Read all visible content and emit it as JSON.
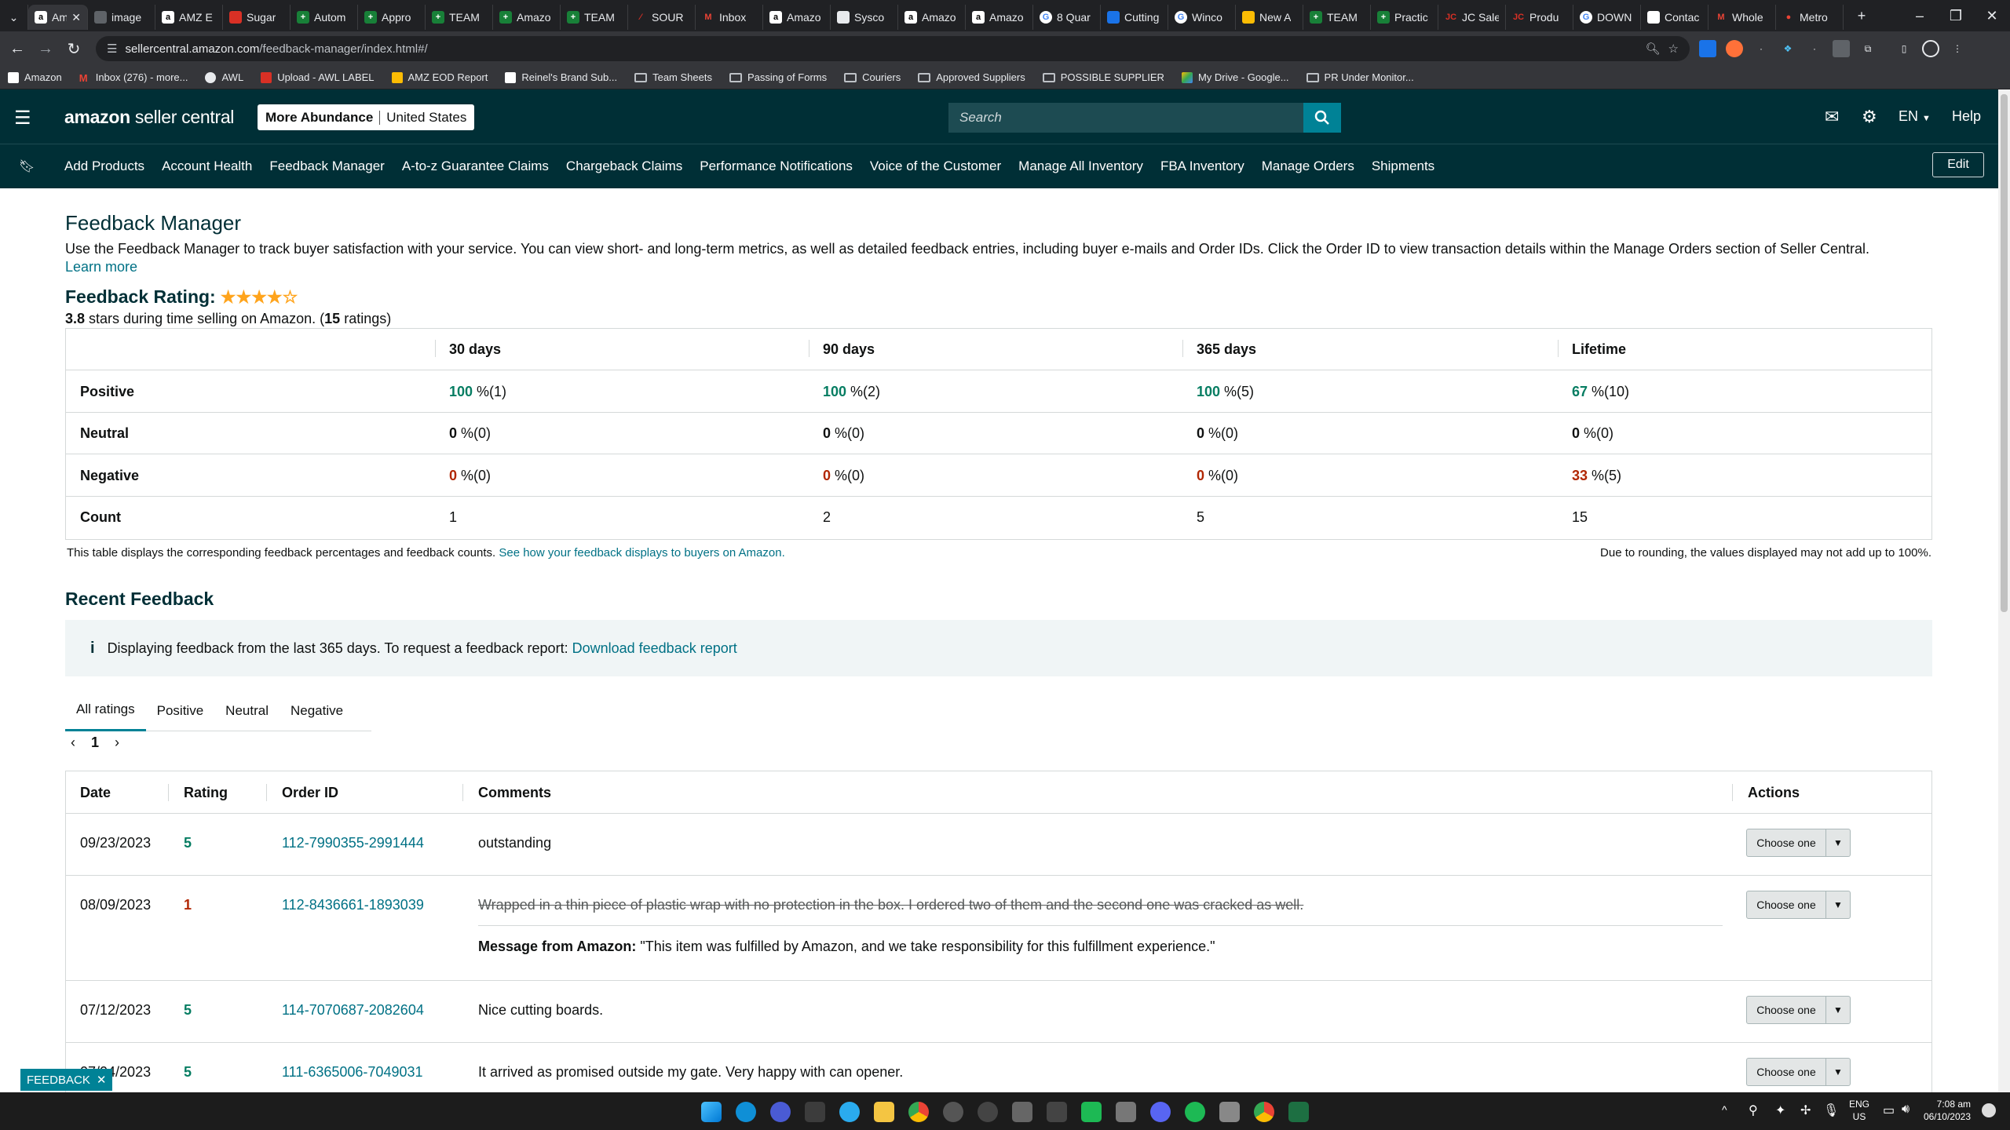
{
  "browser": {
    "tabs": [
      "Am",
      "image",
      "AMZ E",
      "Sugar",
      "Autom",
      "Appro",
      "TEAM",
      "Amazo",
      "TEAM",
      "SOUR",
      "Inbox",
      "Amazo",
      "Sysco",
      "Amazo",
      "Amazo",
      "8 Quar",
      "Cutting",
      "Winco",
      "New A",
      "TEAM",
      "Practic",
      "JC Sale",
      "Produ",
      "DOWN",
      "Contac",
      "Whole",
      "Metro"
    ],
    "url_domain": "sellercentral.amazon.com",
    "url_path": "/feedback-manager/index.html#/",
    "bookmarks": [
      "Amazon",
      "Inbox (276) - more...",
      "AWL",
      "Upload - AWL LABEL",
      "AMZ EOD Report",
      "Reinel's Brand Sub...",
      "Team Sheets",
      "Passing of Forms",
      "Couriers",
      "Approved Suppliers",
      "POSSIBLE SUPPLIER",
      "My Drive - Google...",
      "PR Under Monitor..."
    ]
  },
  "header": {
    "brand_bold": "amazon",
    "brand_rest": " seller central",
    "store": "More Abundance",
    "marketplace": "United States",
    "search_placeholder": "Search",
    "language": "EN",
    "help": "Help"
  },
  "nav": {
    "items": [
      "Add Products",
      "Account Health",
      "Feedback Manager",
      "A-to-z Guarantee Claims",
      "Chargeback Claims",
      "Performance Notifications",
      "Voice of the Customer",
      "Manage All Inventory",
      "FBA Inventory",
      "Manage Orders",
      "Shipments"
    ],
    "edit": "Edit"
  },
  "page": {
    "title": "Feedback Manager",
    "intro": "Use the Feedback Manager to track buyer satisfaction with your service. You can view short- and long-term metrics, as well as detailed feedback entries, including buyer e-mails and Order IDs. Click the Order ID to view transaction details within the Manage Orders section of Seller Central.",
    "learn_more": "Learn more",
    "rating_label": "Feedback Rating:",
    "stars_filled": 4,
    "stars_total": 5,
    "rating_value": "3.8",
    "rating_text_mid": " stars during time selling on Amazon. (",
    "rating_count": "15",
    "rating_text_end": " ratings)"
  },
  "metrics": {
    "columns": [
      "30 days",
      "90 days",
      "365 days",
      "Lifetime"
    ],
    "rows": [
      {
        "label": "Positive",
        "cells": [
          [
            "100",
            " %(1)"
          ],
          [
            "100",
            " %(2)"
          ],
          [
            "100",
            " %(5)"
          ],
          [
            "67",
            " %(10)"
          ]
        ]
      },
      {
        "label": "Neutral",
        "cells": [
          [
            "0",
            " %(0)"
          ],
          [
            "0",
            " %(0)"
          ],
          [
            "0",
            " %(0)"
          ],
          [
            "0",
            " %(0)"
          ]
        ]
      },
      {
        "label": "Negative",
        "cells": [
          [
            "0",
            " %(0)"
          ],
          [
            "0",
            " %(0)"
          ],
          [
            "0",
            " %(0)"
          ],
          [
            "33",
            " %(5)"
          ]
        ]
      },
      {
        "label": "Count",
        "cells": [
          [
            "1",
            ""
          ],
          [
            "2",
            ""
          ],
          [
            "5",
            ""
          ],
          [
            "15",
            ""
          ]
        ]
      }
    ],
    "footnote_left": "This table displays the corresponding feedback percentages and feedback counts.",
    "footnote_link": "See how your feedback displays to buyers on Amazon.",
    "footnote_right": "Due to rounding, the values displayed may not add up to 100%."
  },
  "recent": {
    "title": "Recent Feedback",
    "banner_text": "Displaying feedback from the last 365 days. To request a feedback report:",
    "banner_link": "Download feedback report",
    "tabs": [
      "All ratings",
      "Positive",
      "Neutral",
      "Negative"
    ],
    "page": "1",
    "columns": [
      "Date",
      "Rating",
      "Order ID",
      "Comments",
      "Actions"
    ],
    "rows": [
      {
        "date": "09/23/2023",
        "rating": "5",
        "order": "112-7990355-2991444",
        "comment": "outstanding"
      },
      {
        "date": "08/09/2023",
        "rating": "1",
        "order": "112-8436661-1893039",
        "comment": "Wrapped in a thin piece of plastic wrap with no protection in the box. I ordered two of them and the second one was cracked as well.",
        "msg_label": "Message from Amazon:",
        "msg": " \"This item was fulfilled by Amazon, and we take responsibility for this fulfillment experience.\""
      },
      {
        "date": "07/12/2023",
        "rating": "5",
        "order": "114-7070687-2082604",
        "comment": "Nice cutting boards."
      },
      {
        "date": "07/04/2023",
        "rating": "5",
        "order": "111-6365006-7049031",
        "comment": "It arrived as promised outside my gate. Very happy with can opener."
      }
    ],
    "action_label": "Choose one"
  },
  "feedback_button": "FEEDBACK",
  "taskbar": {
    "lang_top": "ENG",
    "lang_bottom": "US",
    "time": "7:08 am",
    "date": "06/10/2023"
  },
  "colors": {
    "header_bg": "#002f36",
    "teal": "#008296",
    "positive": "#067d62",
    "negative": "#b12704",
    "link": "#007185",
    "star": "#ffa41c"
  }
}
